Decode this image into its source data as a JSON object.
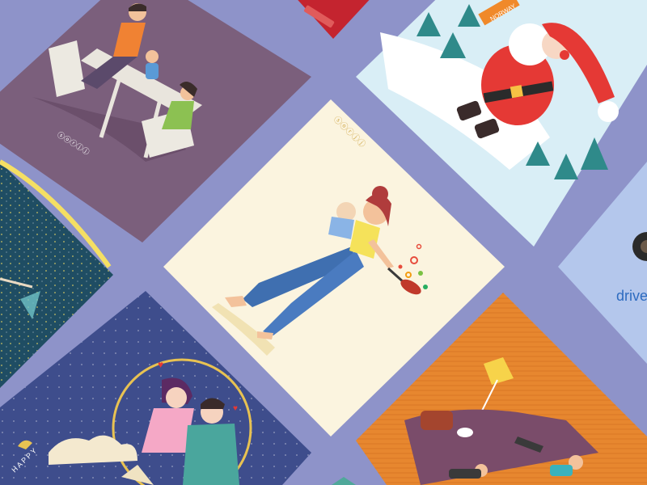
{
  "background_color": "#8e93c9",
  "cards": [
    {
      "id": "family-dinner",
      "bg": "#7b5f7c",
      "logo": "ⓢⓞⓡⓙⓙ"
    },
    {
      "id": "red-card",
      "bg": "#c4242f"
    },
    {
      "id": "santa",
      "bg": "#d9eef6",
      "sign": "NORWAY"
    },
    {
      "id": "night-sky",
      "bg": "#1f4d63"
    },
    {
      "id": "mother-cooking",
      "bg": "#fbf4df",
      "logo": "ⓢⓞⓡⓙⓙ"
    },
    {
      "id": "drive",
      "bg": "#b4c7ec",
      "text": "drive"
    },
    {
      "id": "chinese-lovers",
      "bg": "#3e4d8c",
      "text": "HAPPY"
    },
    {
      "id": "living-room",
      "bg": "#e7872f"
    }
  ]
}
